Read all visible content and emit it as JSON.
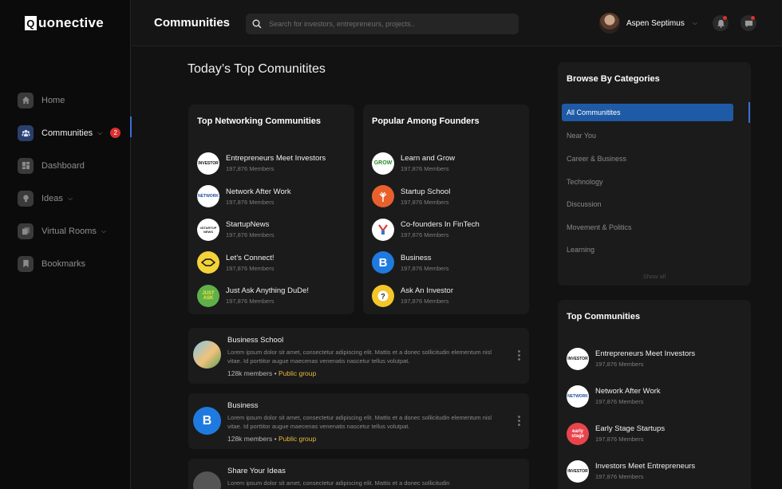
{
  "app": {
    "logo_letter": "Q",
    "logo_rest": "uonective"
  },
  "sidebar": {
    "items": [
      {
        "label": "Home",
        "icon": "home-icon"
      },
      {
        "label": "Communities",
        "icon": "people-icon",
        "badge": "2"
      },
      {
        "label": "Dashboard",
        "icon": "dashboard-icon"
      },
      {
        "label": "Ideas",
        "icon": "bulb-icon"
      },
      {
        "label": "Virtual Rooms",
        "icon": "room-icon"
      },
      {
        "label": "Bookmarks",
        "icon": "bookmark-icon"
      }
    ]
  },
  "header": {
    "title": "Communities",
    "search_placeholder": "Search for investors, entrepreneurs, projects..",
    "user_name": "Aspen Septimus"
  },
  "main": {
    "title": "Today’s Top Comunitites",
    "networking": {
      "title": "Top Networking Communities",
      "items": [
        {
          "name": "Entrepreneurs Meet Investors",
          "members": "197,876 Members"
        },
        {
          "name": "Network After Work",
          "members": "197,876 Members"
        },
        {
          "name": "StartupNews",
          "members": "197,876 Members"
        },
        {
          "name": "Let’s Connect!",
          "members": "197,876 Members"
        },
        {
          "name": "Just Ask Anything DuDe!",
          "members": "197,876 Members"
        }
      ]
    },
    "founders": {
      "title": "Popular Among Founders",
      "items": [
        {
          "name": "Learn and Grow",
          "members": "197,876 Members"
        },
        {
          "name": "Startup School",
          "members": "197,876 Members"
        },
        {
          "name": "Co-founders In FinTech",
          "members": "197,876 Members"
        },
        {
          "name": "Business",
          "members": "197,876 Members"
        },
        {
          "name": "Ask An Investor",
          "members": "197,876 Members"
        }
      ]
    },
    "posts": [
      {
        "title": "Business School",
        "desc": "Lorem ipsum dolor sit amet, consectetur adipiscing elit. Mattis et a donec sollicitudin elementum nisl vitae. Id porttitor augue maecenas venenatis nascetur tellus volutpat.",
        "members": "128k members",
        "sep": "•",
        "type": "Public group"
      },
      {
        "title": "Business",
        "desc": "Lorem ipsum dolor sit amet, consectetur adipiscing elit. Mattis et a donec sollicitudin elementum nisl vitae. Id porttitor augue maecenas venenatis nascetur tellus volutpat.",
        "members": "128k members",
        "sep": "•",
        "type": "Public group"
      },
      {
        "title": "Share Your Ideas",
        "desc": "Lorem ipsum dolor sit amet, consectetur adipiscing elit. Mattis et a donec sollicitudin",
        "members": "",
        "sep": "",
        "type": ""
      }
    ]
  },
  "categories": {
    "title": "Browse By Categories",
    "items": [
      "All Communitites",
      "Near You",
      "Career & Business",
      "Technology",
      "Discussion",
      "Movement & Politics",
      "Learning"
    ],
    "show_all": "Show all"
  },
  "top_communities": {
    "title": "Top Communities",
    "items": [
      {
        "name": "Entrepreneurs Meet Investors",
        "members": "197,876 Members"
      },
      {
        "name": "Network After Work",
        "members": "197,876 Members"
      },
      {
        "name": "Early Stage Startups",
        "members": "197,876 Members"
      },
      {
        "name": "Investors Meet Entrepreneurs",
        "members": "197,876 Members"
      }
    ]
  },
  "logo_text": {
    "investor": "INVESTOR",
    "network": "NETWORK",
    "startup_news": "#STARTUP NEWS",
    "grow": "GROW",
    "b": "B",
    "just_ask": "JUST ASK",
    "early_stage": "early stage"
  },
  "colors": {
    "accent": "#1f5aa6",
    "badge": "#d93030",
    "public_group": "#e8b93c"
  }
}
